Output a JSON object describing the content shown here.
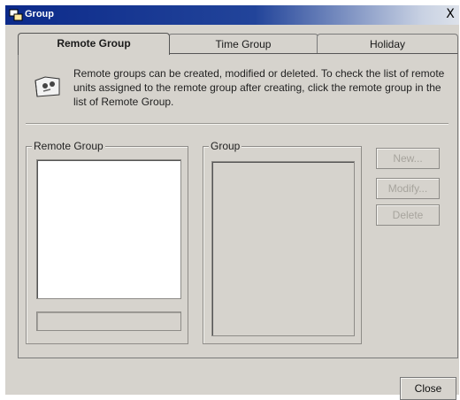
{
  "window": {
    "title": "Group",
    "close_glyph": "X"
  },
  "tabs": [
    {
      "label": "Remote Group",
      "active": true
    },
    {
      "label": "Time Group",
      "active": false
    },
    {
      "label": "Holiday",
      "active": false
    }
  ],
  "info": {
    "icon": "info-folder-icon",
    "text": "Remote groups can be created, modified or deleted. To check the list of remote units assigned to the remote group after creating, click the remote group in the list of Remote Group."
  },
  "remote_group_box": {
    "label": "Remote Group",
    "items": [],
    "field_value": ""
  },
  "group_box": {
    "label": "Group",
    "items": []
  },
  "actions": {
    "new_label": "New...",
    "modify_label": "Modify...",
    "delete_label": "Delete",
    "enabled": false
  },
  "footer": {
    "close_label": "Close"
  }
}
